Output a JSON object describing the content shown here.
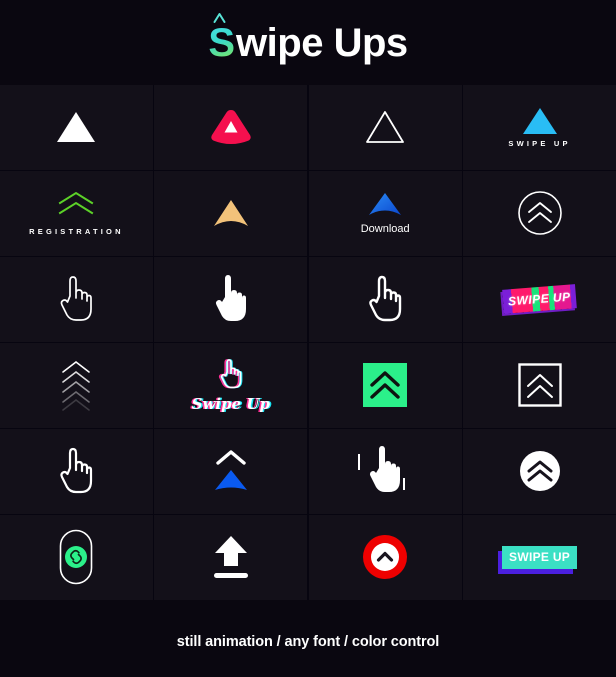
{
  "header": {
    "title_initial": "S",
    "title_rest": "wipe Ups",
    "caret_icon": "caret-up-icon",
    "gradient_start": "#49e0e8",
    "gradient_end": "#8ce84a"
  },
  "colors": {
    "page_background": "#0a0710",
    "cell_background": "#131019",
    "white": "#ffffff",
    "red": "#f5104e",
    "crimson": "#ee0000",
    "green": "#5cd128",
    "mint": "#2bf08a",
    "sand": "#f2c27a",
    "sky_blue": "#29bdf5",
    "blue": "#1464e6",
    "royal_blue": "#0a5af0",
    "magenta": "#ff2d95",
    "cyan": "#19e6f5",
    "purple": "#7b1fd8",
    "teal": "#3be0c4"
  },
  "grid": {
    "columns": 4,
    "rows": 6,
    "cells": [
      {
        "id": "cell-1",
        "icon": "solid-triangle-icon",
        "label": "",
        "color": "#ffffff"
      },
      {
        "id": "cell-2",
        "icon": "rounded-triangle-badge-icon",
        "label": "",
        "color": "#f5104e"
      },
      {
        "id": "cell-3",
        "icon": "outline-triangle-icon",
        "label": "",
        "color": "#ffffff"
      },
      {
        "id": "cell-4",
        "icon": "solid-triangle-icon",
        "label": "SWIPE UP",
        "color": "#29bdf5"
      },
      {
        "id": "cell-5",
        "icon": "double-chevron-up-icon",
        "label": "REGISTRATION",
        "color": "#5cd128"
      },
      {
        "id": "cell-6",
        "icon": "chevron-arrowhead-icon",
        "label": "",
        "color": "#f2c27a"
      },
      {
        "id": "cell-7",
        "icon": "chevron-arrowhead-icon",
        "label": "Download",
        "color": "#1464e6"
      },
      {
        "id": "cell-8",
        "icon": "circle-double-chevron-icon",
        "label": "",
        "color": "#ffffff"
      },
      {
        "id": "cell-9",
        "icon": "outline-pointing-hand-icon",
        "label": "",
        "color": "#ffffff"
      },
      {
        "id": "cell-10",
        "icon": "solid-pointing-hand-icon",
        "label": "",
        "color": "#ffffff"
      },
      {
        "id": "cell-11",
        "icon": "outline-pointing-hand-icon",
        "label": "",
        "color": "#ffffff"
      },
      {
        "id": "cell-12",
        "icon": "glitch-banner-icon",
        "label": "SWIPE UP",
        "color": "#ff1a6b"
      },
      {
        "id": "cell-13",
        "icon": "stacked-chevrons-icon",
        "label": "",
        "color": "#ffffff"
      },
      {
        "id": "cell-14",
        "icon": "outline-pointing-hand-icon",
        "label": "Swipe Up",
        "color": "#ffffff"
      },
      {
        "id": "cell-15",
        "icon": "square-double-chevron-icon",
        "label": "",
        "color": "#2bf08a"
      },
      {
        "id": "cell-16",
        "icon": "square-outline-double-chevron-icon",
        "label": "",
        "color": "#ffffff"
      },
      {
        "id": "cell-17",
        "icon": "outline-pointing-hand-icon",
        "label": "",
        "color": "#ffffff"
      },
      {
        "id": "cell-18",
        "icon": "chevron-over-fan-icon",
        "label": "",
        "color": "#0a5af0"
      },
      {
        "id": "cell-19",
        "icon": "solid-pointing-hand-icon",
        "label": "",
        "color": "#ffffff"
      },
      {
        "id": "cell-20",
        "icon": "white-circle-double-chevron-icon",
        "label": "",
        "color": "#ffffff"
      },
      {
        "id": "cell-21",
        "icon": "link-pill-icon",
        "label": "",
        "color": "#2bf08a"
      },
      {
        "id": "cell-22",
        "icon": "upload-arrow-bar-icon",
        "label": "",
        "color": "#ffffff"
      },
      {
        "id": "cell-23",
        "icon": "red-circle-chevron-icon",
        "label": "",
        "color": "#ee0000"
      },
      {
        "id": "cell-24",
        "icon": "teal-banner-icon",
        "label": "SWIPE UP",
        "color": "#3be0c4"
      }
    ]
  },
  "footer": {
    "caption": "still animation / any font / color control"
  }
}
